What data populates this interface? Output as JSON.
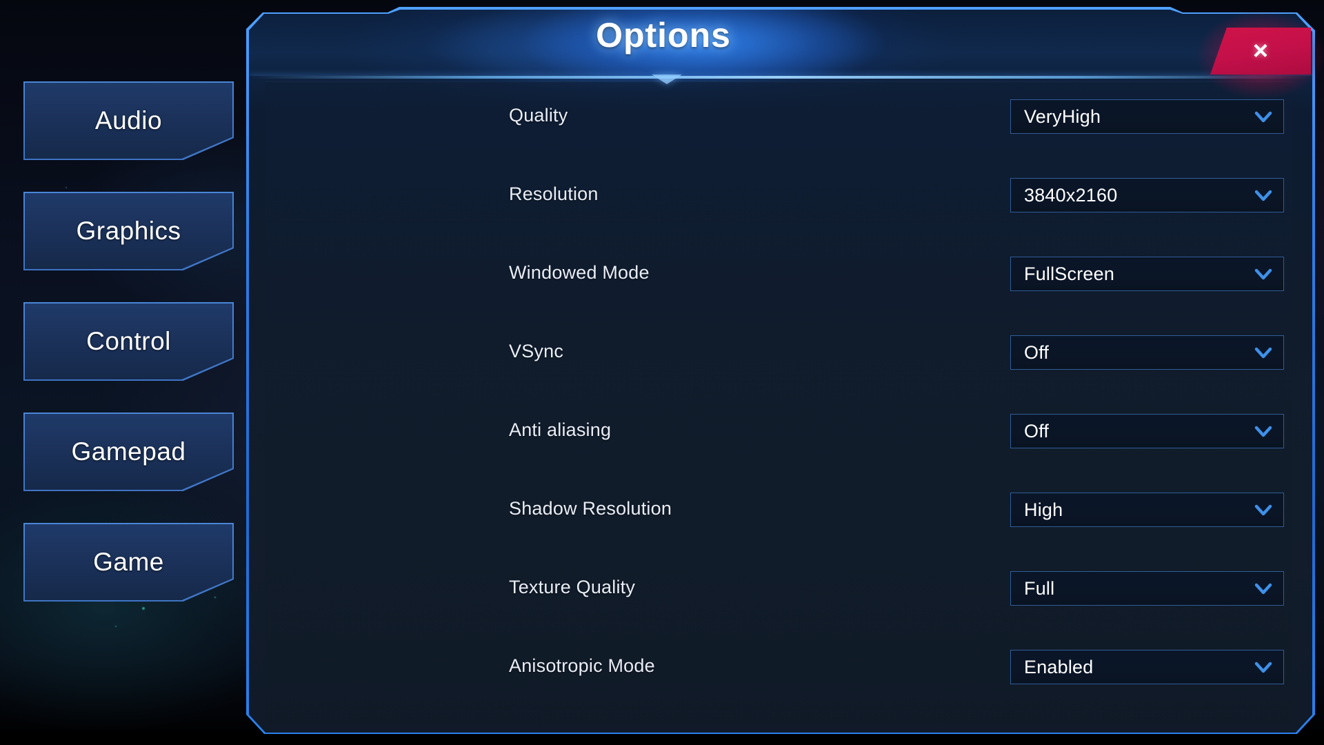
{
  "window": {
    "title": "Options",
    "close_label": "×",
    "close_icon": "close-x-icon"
  },
  "theme": {
    "accent_blue": "#3f8bf0",
    "border_blue": "#2f5d97",
    "panel_bg": "#0d1c32",
    "title_glow": "#2e7ee8",
    "close_red": "#c4104a",
    "text_primary": "#ffffff",
    "chevron_blue": "#3f90e8"
  },
  "sidebar": {
    "items": [
      {
        "label": "Audio",
        "name": "sidebar-item-audio",
        "selected": false
      },
      {
        "label": "Graphics",
        "name": "sidebar-item-graphics",
        "selected": true
      },
      {
        "label": "Control",
        "name": "sidebar-item-control",
        "selected": false
      },
      {
        "label": "Gamepad",
        "name": "sidebar-item-gamepad",
        "selected": false
      },
      {
        "label": "Game",
        "name": "sidebar-item-game",
        "selected": false
      }
    ]
  },
  "options": {
    "rows": [
      {
        "label": "Quality",
        "value": "VeryHigh",
        "icon": "chevron-down-icon"
      },
      {
        "label": "Resolution",
        "value": "3840x2160",
        "icon": "chevron-down-icon"
      },
      {
        "label": "Windowed Mode",
        "value": "FullScreen",
        "icon": "chevron-down-icon"
      },
      {
        "label": "VSync",
        "value": "Off",
        "icon": "chevron-down-icon"
      },
      {
        "label": "Anti aliasing",
        "value": "Off",
        "icon": "chevron-down-icon"
      },
      {
        "label": "Shadow Resolution",
        "value": "High",
        "icon": "chevron-down-icon"
      },
      {
        "label": "Texture Quality",
        "value": "Full",
        "icon": "chevron-down-icon"
      },
      {
        "label": "Anisotropic Mode",
        "value": "Enabled",
        "icon": "chevron-down-icon"
      }
    ]
  }
}
